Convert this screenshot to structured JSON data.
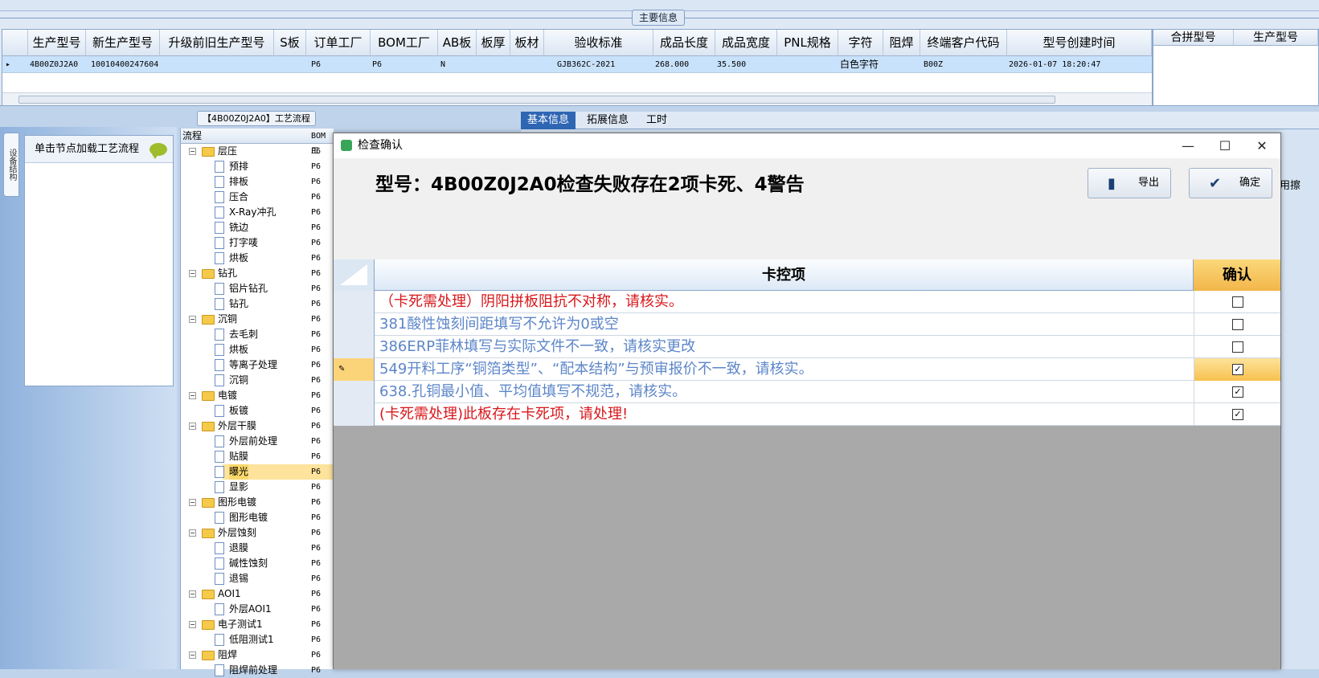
{
  "main_info": {
    "caption": "主要信息",
    "columns": [
      "生产型号",
      "新生产型号",
      "升级前旧生产型号",
      "S板",
      "订单工厂",
      "BOM工厂",
      "AB板",
      "板厚",
      "板材",
      "验收标准",
      "成品长度",
      "成品宽度",
      "PNL规格",
      "字符",
      "阻焊",
      "终端客户代码",
      "型号创建时间"
    ],
    "row": {
      "indicator": "▸",
      "prod_model": "4B00Z0J2A0",
      "new_model": "10010400247604",
      "order_factory": "P6",
      "bom_factory": "P6",
      "ab": "N",
      "standard": "GJB362C-2021",
      "length": "268.000",
      "width": "35.500",
      "char": "白色字符",
      "customer": "B00Z",
      "created": "2026-01-07 18:20:47"
    },
    "right_columns": [
      "合拼型号",
      "生产型号"
    ]
  },
  "process": {
    "caption": "【4B00Z0J2A0】工艺流程",
    "side_tab": "设备结构",
    "load_hint": "单击节点加载工艺流程",
    "tree_header": "流程",
    "bom_header": "BOM工",
    "nodes": [
      {
        "label": "层压",
        "type": "folder",
        "bom": "P6"
      },
      {
        "label": "预排",
        "type": "doc",
        "bom": "P6"
      },
      {
        "label": "排板",
        "type": "doc",
        "bom": "P6"
      },
      {
        "label": "压合",
        "type": "doc",
        "bom": "P6"
      },
      {
        "label": "X-Ray冲孔",
        "type": "doc",
        "bom": "P6"
      },
      {
        "label": "铣边",
        "type": "doc",
        "bom": "P6"
      },
      {
        "label": "打字唛",
        "type": "doc",
        "bom": "P6"
      },
      {
        "label": "烘板",
        "type": "doc",
        "bom": "P6"
      },
      {
        "label": "钻孔",
        "type": "folder",
        "bom": "P6"
      },
      {
        "label": "铝片钻孔",
        "type": "doc",
        "bom": "P6"
      },
      {
        "label": "钻孔",
        "type": "doc",
        "bom": "P6"
      },
      {
        "label": "沉铜",
        "type": "folder",
        "bom": "P6"
      },
      {
        "label": "去毛刺",
        "type": "doc",
        "bom": "P6"
      },
      {
        "label": "烘板",
        "type": "doc",
        "bom": "P6"
      },
      {
        "label": "等离子处理",
        "type": "doc",
        "bom": "P6"
      },
      {
        "label": "沉铜",
        "type": "doc",
        "bom": "P6"
      },
      {
        "label": "电镀",
        "type": "folder",
        "bom": "P6"
      },
      {
        "label": "板镀",
        "type": "doc",
        "bom": "P6"
      },
      {
        "label": "外层干膜",
        "type": "folder",
        "bom": "P6"
      },
      {
        "label": "外层前处理",
        "type": "doc",
        "bom": "P6"
      },
      {
        "label": "贴膜",
        "type": "doc",
        "bom": "P6"
      },
      {
        "label": "曝光",
        "type": "doc",
        "bom": "P6",
        "selected": true
      },
      {
        "label": "显影",
        "type": "doc",
        "bom": "P6"
      },
      {
        "label": "图形电镀",
        "type": "folder",
        "bom": "P6"
      },
      {
        "label": "图形电镀",
        "type": "doc",
        "bom": "P6"
      },
      {
        "label": "外层蚀刻",
        "type": "folder",
        "bom": "P6"
      },
      {
        "label": "退膜",
        "type": "doc",
        "bom": "P6"
      },
      {
        "label": "碱性蚀刻",
        "type": "doc",
        "bom": "P6"
      },
      {
        "label": "退锡",
        "type": "doc",
        "bom": "P6"
      },
      {
        "label": "AOI1",
        "type": "folder",
        "bom": "P6"
      },
      {
        "label": "外层AOI1",
        "type": "doc",
        "bom": "P6"
      },
      {
        "label": "电子测试1",
        "type": "folder",
        "bom": "P6"
      },
      {
        "label": "低阻测试1",
        "type": "doc",
        "bom": "P6"
      },
      {
        "label": "阻焊",
        "type": "folder",
        "bom": "P6"
      },
      {
        "label": "阻焊前处理",
        "type": "doc",
        "bom": "P6"
      }
    ]
  },
  "right_tabs": [
    "基本信息",
    "拓展信息",
    "工时"
  ],
  "right_cut_text": "用擦",
  "dialog": {
    "title": "检查确认",
    "heading": "型号：4B00Z0J2A0检查失败存在2项卡死、4警告",
    "export_label": "导出",
    "confirm_label": "确定",
    "col_item": "卡控项",
    "col_confirm": "确认",
    "rows": [
      {
        "text": "（卡死需处理）阴阳拼板阻抗不对称，请核实。",
        "color": "#d8171b",
        "checked": false
      },
      {
        "text": "381酸性蚀刻间距填写不允许为0或空",
        "color": "#5c86c8",
        "checked": false
      },
      {
        "text": "386ERP菲林填写与实际文件不一致，请核实更改",
        "color": "#5c86c8",
        "checked": false
      },
      {
        "text": "549开料工序“铜箔类型”、“配本结构”与预审报价不一致，请核实。",
        "color": "#5c86c8",
        "checked": true,
        "current": true
      },
      {
        "text": "638.孔铜最小值、平均值填写不规范，请核实。",
        "color": "#5c86c8",
        "checked": true
      },
      {
        "text": "(卡死需处理)此板存在卡死项，请处理!",
        "color": "#d8171b",
        "checked": true
      }
    ]
  },
  "icons": {
    "check": "☑",
    "uncheck": "☐",
    "minimize": "—",
    "maximize": "☐",
    "close": "✕"
  }
}
